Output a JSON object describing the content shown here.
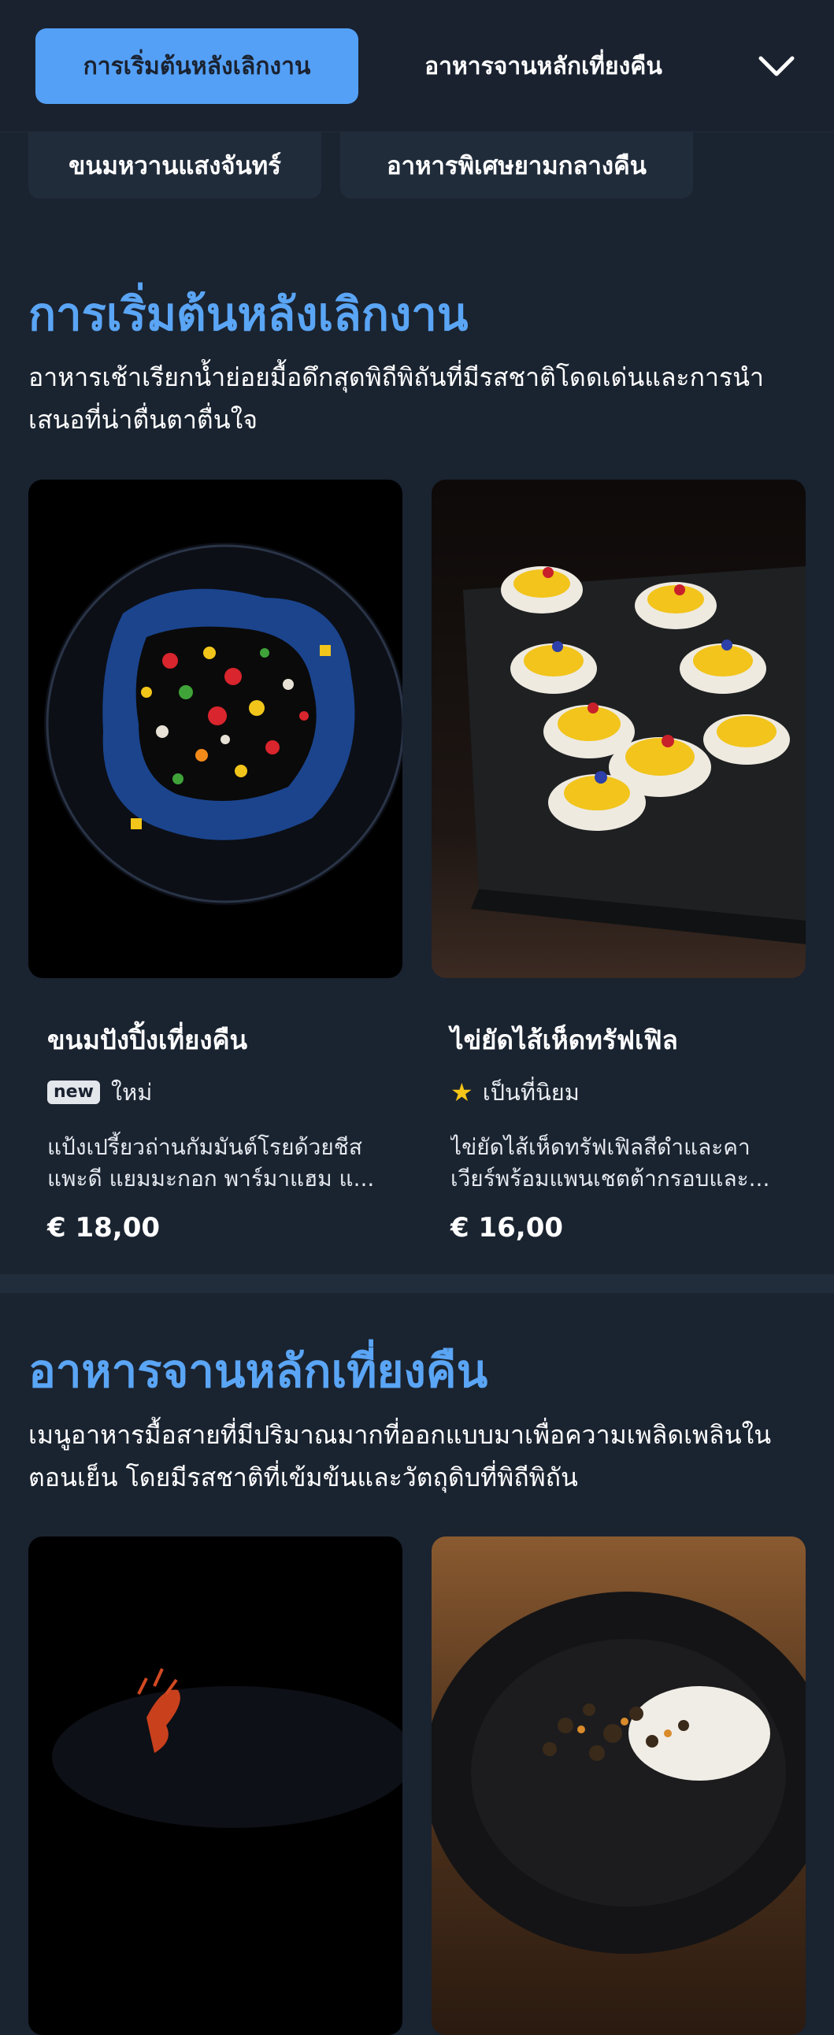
{
  "nav": {
    "active_category": "การเริ่มต้นหลังเลิกงาน",
    "next_category": "อาหารจานหลักเที่ยงคืน",
    "subcategories": [
      "ขนมหวานแสงจันทร์",
      "อาหารพิเศษยามกลางคืน"
    ]
  },
  "sections": [
    {
      "title": "การเริ่มต้นหลังเลิกงาน",
      "description": "อาหารเช้าเรียกน้ำย่อยมื้อดึกสุดพิถีพิถันที่มีรสชาติโดดเด่นและการนำเสนอที่น่าตื่นตาตื่นใจ",
      "items": [
        {
          "name": "ขนมปังปิ้งเที่ยงคืน",
          "badge": "new",
          "tag": "ใหม่",
          "description": "แป้งเปรี้ยวถ่านกัมมันต์โรยด้วยชีสแพะดี แยมมะกอก พาร์มาแฮม แ...",
          "price": "€ 18,00"
        },
        {
          "name": "ไข่ยัดไส้เห็ดทรัฟเฟิล",
          "tag": "เป็นที่นิยม",
          "description": "ไข่ยัดไส้เห็ดทรัฟเฟิลสีดำและคาเวียร์พร้อมแพนเชตต้ากรอบและ...",
          "price": "€ 16,00"
        }
      ]
    },
    {
      "title": "อาหารจานหลักเที่ยงคืน",
      "description": "เมนูอาหารมื้อสายที่มีปริมาณมากที่ออกแบบมาเพื่อความเพลิดเพลินในตอนเย็น โดยมีรสชาติที่เข้มข้นและวัตถุดิบที่พิถีพิถัน"
    }
  ],
  "colors": {
    "background": "#1a2330",
    "accent": "#54a0f7",
    "title": "#5aa5f5",
    "star": "#f5c518"
  }
}
